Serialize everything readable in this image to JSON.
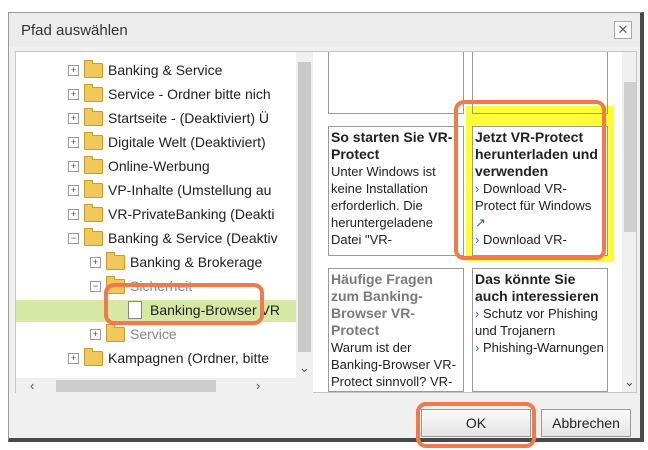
{
  "dialog": {
    "title": "Pfad auswählen",
    "close_glyph": "✕"
  },
  "tree": {
    "items": [
      {
        "label": "Banking & Service",
        "exp": "+"
      },
      {
        "label": "Service - Ordner bitte nich",
        "exp": "+"
      },
      {
        "label": "Startseite - (Deaktiviert) Ü",
        "exp": "+"
      },
      {
        "label": "Digitale Welt (Deaktiviert)",
        "exp": "+"
      },
      {
        "label": "Online-Werbung",
        "exp": "+"
      },
      {
        "label": "VP-Inhalte (Umstellung au",
        "exp": "+"
      },
      {
        "label": "VR-PrivateBanking (Deakti",
        "exp": "+"
      },
      {
        "label": "Banking & Service (Deaktiv",
        "exp": "−"
      },
      {
        "label": "Banking & Brokerage",
        "exp": "+"
      },
      {
        "label": "Sicherheit",
        "exp": "−"
      },
      {
        "label": "Banking-Browser VR",
        "exp": ""
      },
      {
        "label": "Service",
        "exp": "+"
      },
      {
        "label": "Kampagnen (Ordner, bitte",
        "exp": "+"
      }
    ]
  },
  "preview": {
    "box1": {
      "title": "So starten Sie VR-Protect",
      "text": "Unter Windows ist keine Installation erforderlich. Die heruntergeladene Datei \"VR-"
    },
    "box2": {
      "title": "Jetzt VR-Protect herunterladen und verwenden",
      "link1": "Download VR-Protect für Windows",
      "link2": "Download VR-"
    },
    "box3": {
      "title": "Häufige Fragen zum Banking-Browser VR-Protect",
      "text": "Warum ist der Banking-Browser VR-Protect sinnvoll? VR-Protect ist ein sogenannter"
    },
    "box4": {
      "title": "Das könnte Sie auch interessieren",
      "link1": "Schutz vor Phishing und Trojanern",
      "link2": "Phishing-Warnungen"
    }
  },
  "buttons": {
    "ok": "OK",
    "cancel": "Abbrechen"
  },
  "colors": {
    "highlight": "#f07a4a",
    "yellow": "#ffff33",
    "selection": "#d6e7a6"
  }
}
